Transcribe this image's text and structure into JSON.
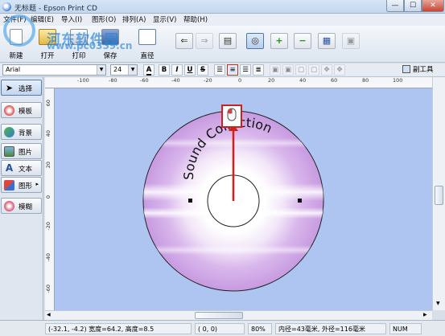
{
  "window": {
    "title": "无标题 - Epson Print CD",
    "minimize_glyph": "—",
    "maximize_glyph": "☐",
    "close_glyph": "✕"
  },
  "menu": [
    "文件(F)",
    "编辑(E)",
    "导入(I)",
    "图形(O)",
    "排列(A)",
    "显示(V)",
    "帮助(H)"
  ],
  "watermark": {
    "name": "河东软件园",
    "url": "www.pc0359.cn"
  },
  "toolbar": {
    "buttons": [
      {
        "label": "新建",
        "icon": "new-document-icon"
      },
      {
        "label": "打开",
        "icon": "open-folder-icon"
      },
      {
        "label": "打印",
        "icon": "printer-icon"
      },
      {
        "label": "保存",
        "icon": "save-icon"
      },
      {
        "label": "直径",
        "icon": "diameter-icon"
      }
    ]
  },
  "format": {
    "font": "Arial",
    "size": "24",
    "bold": "B",
    "italic": "I",
    "underline": "U",
    "strike": "S",
    "subtool_label": "副工具"
  },
  "left_panel": [
    {
      "label": "选择",
      "icon": "select-arrow-icon",
      "active": true
    },
    {
      "label": "模板",
      "icon": "template-icon",
      "active": false
    },
    {
      "label": "背景",
      "icon": "background-icon",
      "active": false
    },
    {
      "label": "图片",
      "icon": "picture-icon",
      "active": false
    },
    {
      "label": "文本",
      "icon": "text-icon",
      "active": false
    },
    {
      "label": "图形",
      "icon": "shape-icon",
      "active": false
    },
    {
      "label": "模糊",
      "icon": "blur-icon",
      "active": false
    }
  ],
  "ruler_top_labels": [
    "-100",
    "-80",
    "-60",
    "-40",
    "-20",
    "0",
    "20",
    "40",
    "60",
    "80",
    "100"
  ],
  "ruler_left_labels": [
    "60",
    "40",
    "20",
    "0",
    "-20",
    "-40",
    "-60"
  ],
  "disc": {
    "text": "Sound Collection"
  },
  "status": {
    "selection": "(-32.1, -4.2) 宽度=64.2, 高度=8.5",
    "cursor": "(    0,     0)",
    "zoom": "80%",
    "diameters": "内径=43毫米, 外径=116毫米",
    "num": "NUM"
  },
  "colors": {
    "canvas_bg": "#aec5f1",
    "highlight_box": "#d0201a"
  }
}
